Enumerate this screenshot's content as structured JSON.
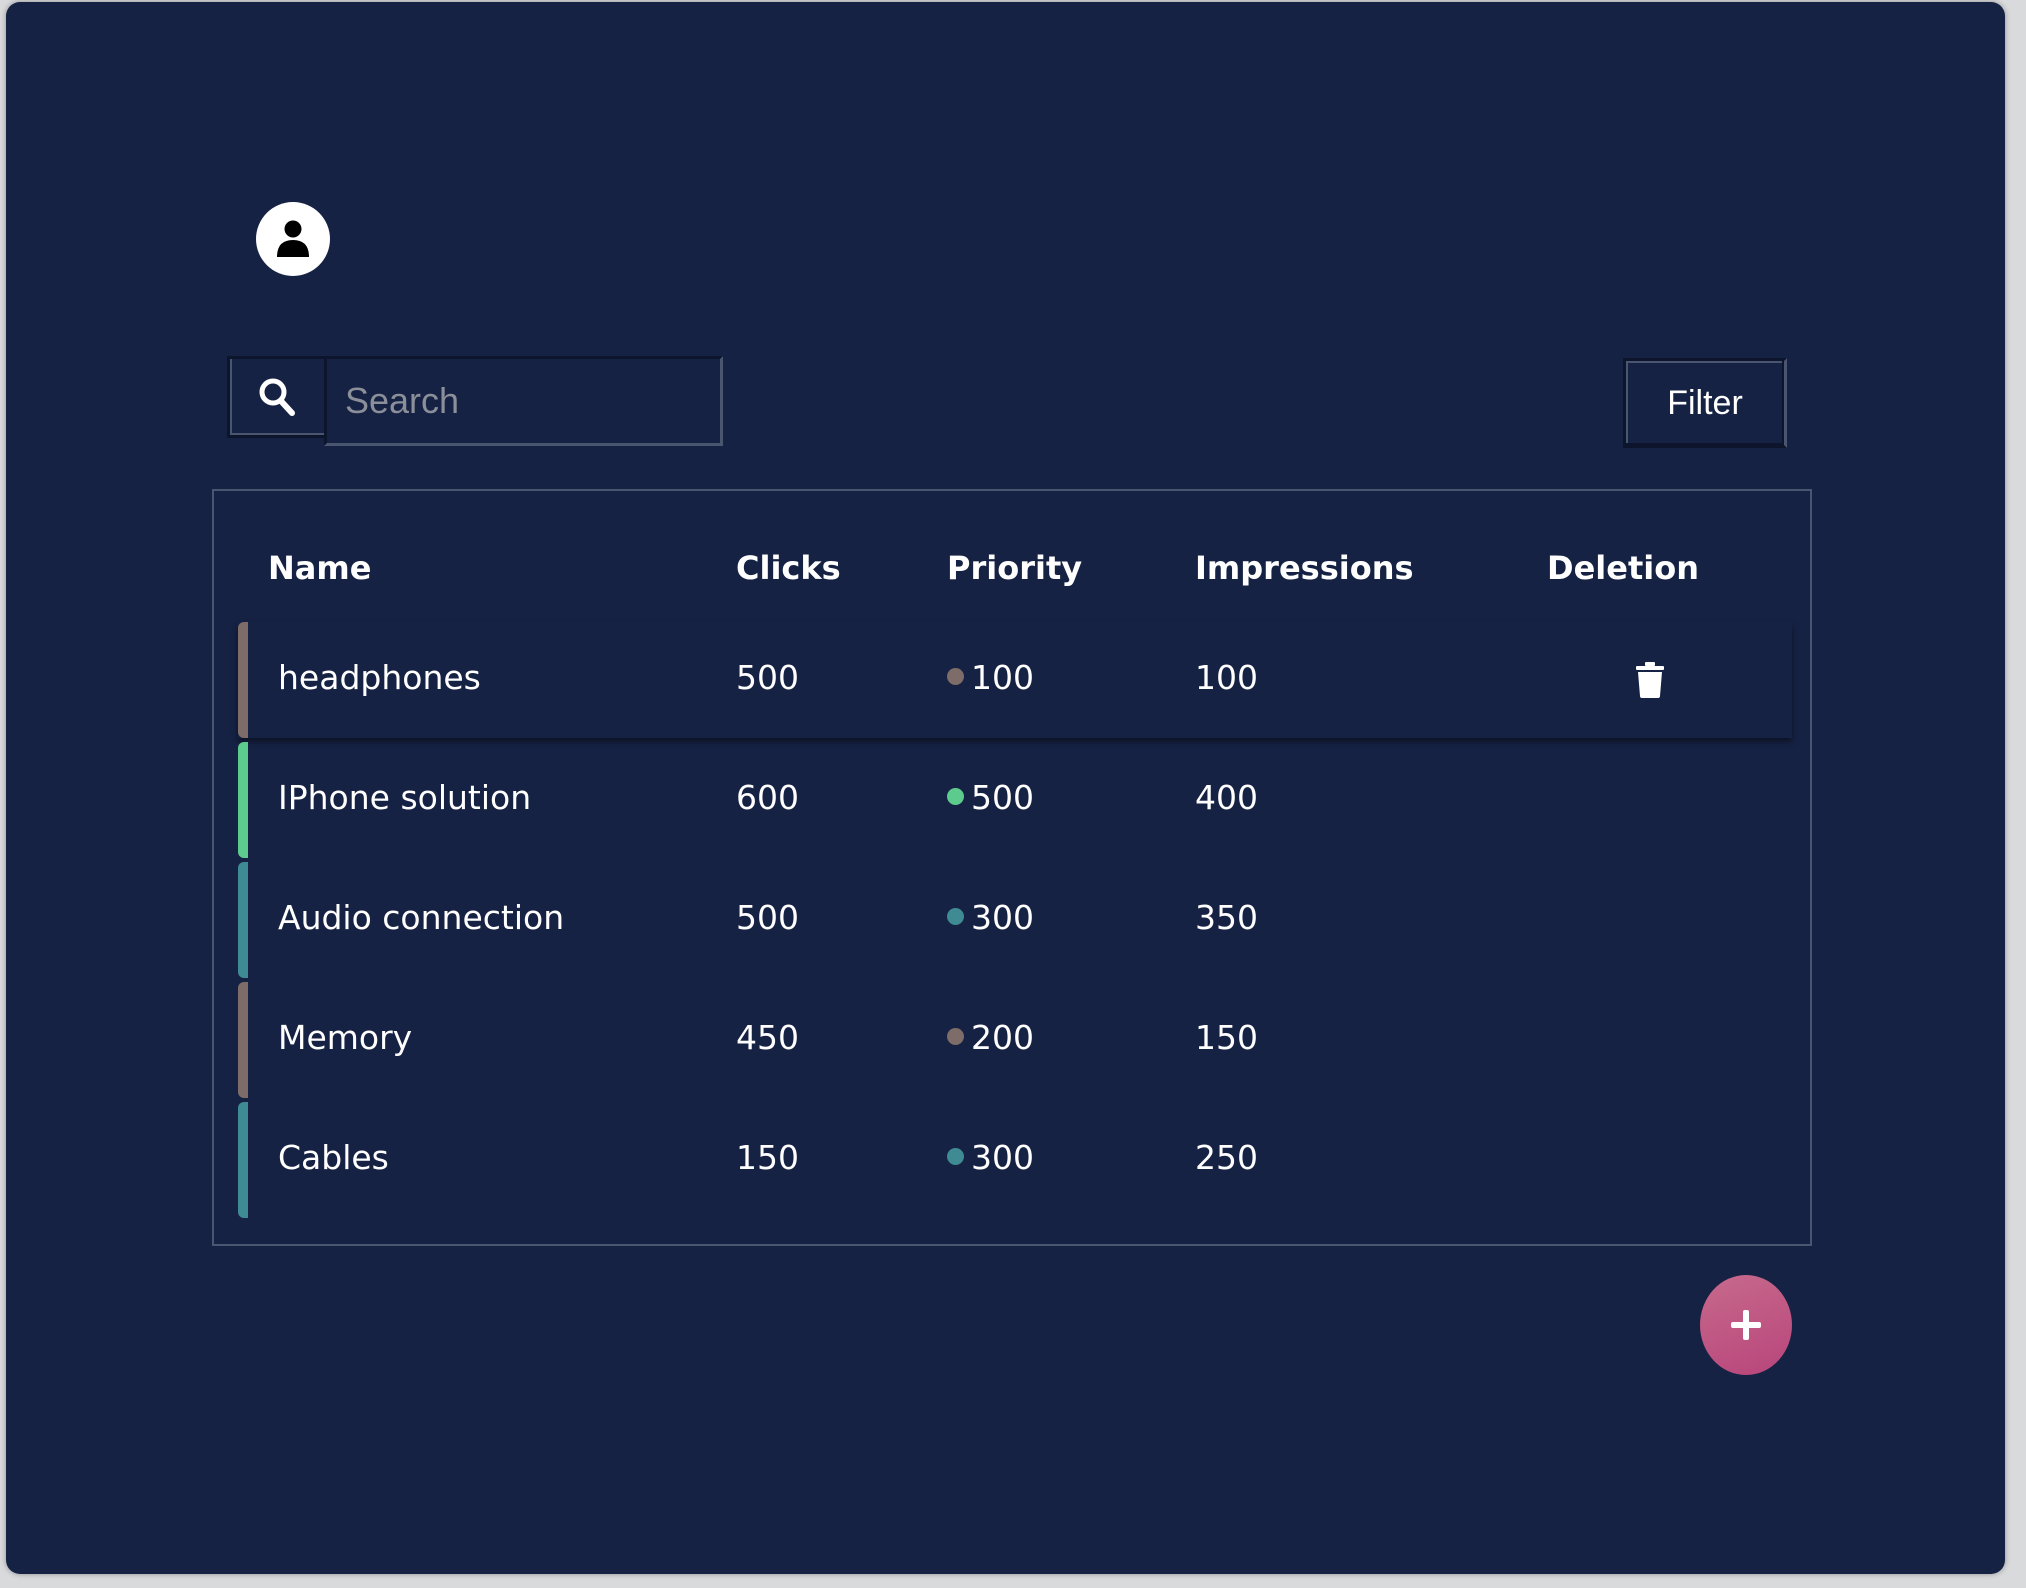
{
  "search": {
    "placeholder": "Search",
    "value": ""
  },
  "filter_label": "Filter",
  "table": {
    "columns": [
      "Name",
      "Clicks",
      "Priority",
      "Impressions",
      "Deletion"
    ],
    "rows": [
      {
        "name": "headphones",
        "clicks": "500",
        "priority": "100",
        "impressions": "100",
        "accent": "#7d6c68",
        "dot": "#7d6c68",
        "highlight": true
      },
      {
        "name": "IPhone solution",
        "clicks": "600",
        "priority": "500",
        "impressions": "400",
        "accent": "#5ecb8e",
        "dot": "#5ecb8e"
      },
      {
        "name": "Audio connection",
        "clicks": "500",
        "priority": "300",
        "impressions": "350",
        "accent": "#3f8b93",
        "dot": "#3f8b93"
      },
      {
        "name": "Memory",
        "clicks": "450",
        "priority": "200",
        "impressions": "150",
        "accent": "#7d6c68",
        "dot": "#7d6c68"
      },
      {
        "name": "Cables",
        "clicks": "150",
        "priority": "300",
        "impressions": "250",
        "accent": "#3f8b93",
        "dot": "#3f8b93"
      }
    ]
  },
  "icons": {
    "avatar": "user-icon",
    "search": "search-icon",
    "delete": "trash-icon",
    "add": "plus-icon"
  },
  "colors": {
    "background": "#162244",
    "add_button_start": "#c76a8c",
    "add_button_end": "#b8457b"
  }
}
